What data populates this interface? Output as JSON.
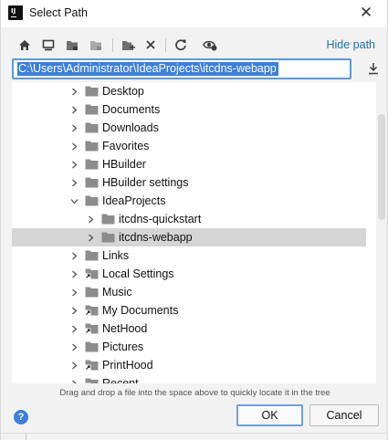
{
  "window": {
    "title": "Select Path"
  },
  "toolbar": {
    "buttons": [
      {
        "name": "home-icon"
      },
      {
        "name": "desktop-icon"
      },
      {
        "name": "project-folder-icon"
      },
      {
        "name": "module-folder-icon"
      },
      {
        "name": "new-folder-icon"
      },
      {
        "name": "delete-icon"
      },
      {
        "name": "refresh-icon"
      },
      {
        "name": "show-hidden-icon"
      }
    ],
    "hide_path_label": "Hide path"
  },
  "path": {
    "value": "C:\\Users\\Administrator\\IdeaProjects\\itcdns-webapp"
  },
  "tree": {
    "items": [
      {
        "label": "Desktop",
        "level": 1,
        "type": "folder"
      },
      {
        "label": "Documents",
        "level": 1,
        "type": "folder"
      },
      {
        "label": "Downloads",
        "level": 1,
        "type": "folder"
      },
      {
        "label": "Favorites",
        "level": 1,
        "type": "folder"
      },
      {
        "label": "HBuilder",
        "level": 1,
        "type": "folder"
      },
      {
        "label": "HBuilder settings",
        "level": 1,
        "type": "folder"
      },
      {
        "label": "IdeaProjects",
        "level": 1,
        "type": "folder",
        "expanded": true
      },
      {
        "label": "itcdns-quickstart",
        "level": 2,
        "type": "folder"
      },
      {
        "label": "itcdns-webapp",
        "level": 2,
        "type": "folder",
        "selected": true
      },
      {
        "label": "Links",
        "level": 1,
        "type": "folder"
      },
      {
        "label": "Local Settings",
        "level": 1,
        "type": "shortcut"
      },
      {
        "label": "Music",
        "level": 1,
        "type": "folder"
      },
      {
        "label": "My Documents",
        "level": 1,
        "type": "shortcut"
      },
      {
        "label": "NetHood",
        "level": 1,
        "type": "shortcut"
      },
      {
        "label": "Pictures",
        "level": 1,
        "type": "folder"
      },
      {
        "label": "PrintHood",
        "level": 1,
        "type": "shortcut"
      },
      {
        "label": "Recent",
        "level": 1,
        "type": "shortcut"
      }
    ]
  },
  "hint": "Drag and drop a file into the space above to quickly locate it in the tree",
  "footer": {
    "help_label": "?",
    "ok_label": "OK",
    "cancel_label": "Cancel"
  },
  "colors": {
    "accent": "#3d7fdb",
    "link": "#2470b3",
    "selection_row": "#d5d5d5",
    "folder": "#8c8c8c"
  }
}
